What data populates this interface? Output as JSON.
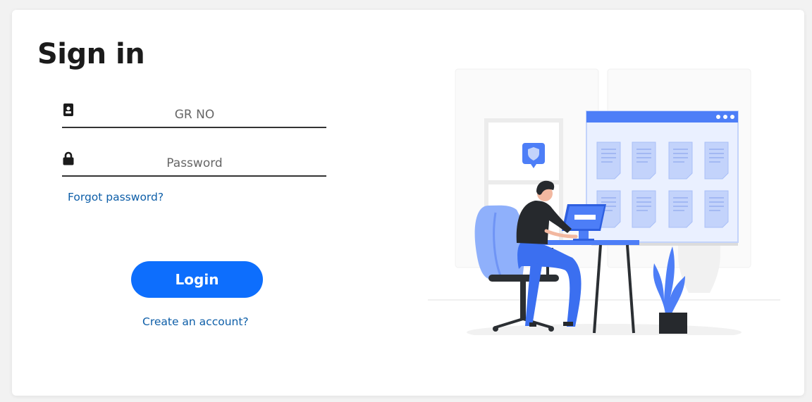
{
  "page": {
    "title": "Sign in"
  },
  "form": {
    "gr_no": {
      "icon": "id-badge-icon",
      "placeholder": "GR NO",
      "value": ""
    },
    "password": {
      "icon": "lock-icon",
      "placeholder": "Password",
      "value": ""
    },
    "forgot_label": "Forgot password?",
    "login_label": "Login",
    "create_label": "Create an account?"
  },
  "colors": {
    "accent": "#0d6efd",
    "link": "#0d5ea8",
    "illustration_blue": "#4d7ef7",
    "illustration_light_blue": "#c3d3fb"
  }
}
